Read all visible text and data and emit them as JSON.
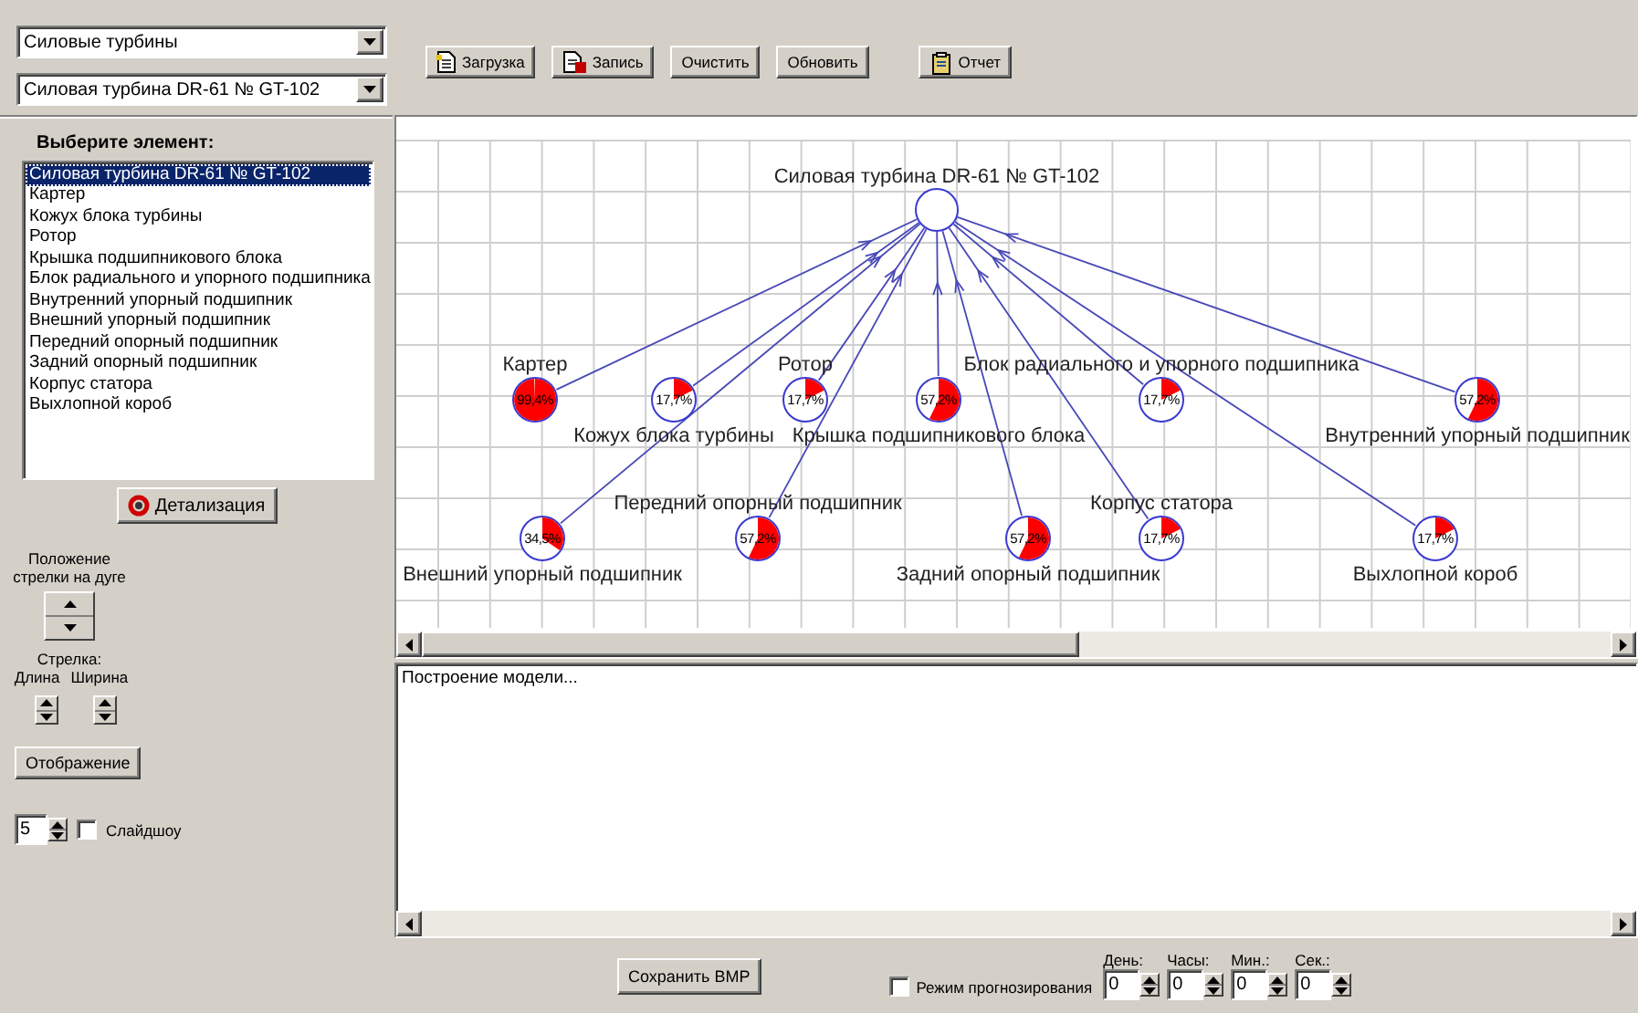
{
  "selectors": [
    {
      "value": "Силовые турбины"
    },
    {
      "value": "Силовая турбина DR-61 № GT-102"
    }
  ],
  "toolbar": [
    {
      "label": "Загрузка",
      "kind": "load"
    },
    {
      "label": "Запись",
      "kind": "save"
    },
    {
      "label": "Очистить",
      "kind": "plain"
    },
    {
      "label": "Обновить",
      "kind": "plain"
    },
    {
      "label": "Отчет",
      "kind": "report"
    }
  ],
  "element_list": {
    "title": "Выберите элемент:",
    "items": [
      {
        "label": "Силовая турбина DR-61 № GT-102",
        "selected": true
      },
      {
        "label": "Картер",
        "selected": false
      },
      {
        "label": "Кожух блока турбины",
        "selected": false
      },
      {
        "label": "Ротор",
        "selected": false
      },
      {
        "label": "Крышка подшипникового блока",
        "selected": false
      },
      {
        "label": "Блок радиального и упорного подшипника",
        "selected": false
      },
      {
        "label": "Внутренний упорный подшипник",
        "selected": false
      },
      {
        "label": "Внешний упорный подшипник",
        "selected": false
      },
      {
        "label": "Передний опорный подшипник",
        "selected": false
      },
      {
        "label": "Задний опорный подшипник",
        "selected": false
      },
      {
        "label": "Корпус статора",
        "selected": false
      },
      {
        "label": "Выхлопной короб",
        "selected": false
      }
    ]
  },
  "detail_button": "Детализация",
  "arrow_position_label": "Положение стрелки на дуге",
  "arrow_label": "Стрелка:",
  "length_label": "Длина",
  "width_label": "Ширина",
  "display_button": "Отображение",
  "slideshow": {
    "interval": "5",
    "label": "Слайдшоу",
    "checked": false
  },
  "diagram": {
    "root": "Силовая турбина DR-61 № GT-102",
    "nodes": [
      {
        "label": "Картер",
        "value": "99,4%"
      },
      {
        "label": "Кожух блока турбины",
        "value": "17,7%"
      },
      {
        "label": "Ротор",
        "value": "17,7%"
      },
      {
        "label": "Крышка подшипникового блока",
        "value": "57,2%"
      },
      {
        "label": "Блок радиального и упорного подшипника",
        "value": "17,7%"
      },
      {
        "label": "Внутренний упорный подшипник",
        "value": "57,2%"
      },
      {
        "label": "Внешний упорный подшипник",
        "value": "34,5%"
      },
      {
        "label": "Передний опорный подшипник",
        "value": "57,2%"
      },
      {
        "label": "Задний опорный подшипник",
        "value": "57,2%"
      },
      {
        "label": "Корпус статора",
        "value": "17,7%"
      },
      {
        "label": "Выхлопной короб",
        "value": "17,7%"
      }
    ]
  },
  "log": [
    "Построение модели..."
  ],
  "save_button": "Сохранить BMP",
  "forecast": {
    "label": "Режим прогнозирования",
    "checked": false,
    "fields": [
      {
        "label": "День:",
        "value": "0"
      },
      {
        "label": "Часы:",
        "value": "0"
      },
      {
        "label": "Мин.:",
        "value": "0"
      },
      {
        "label": "Сек.:",
        "value": "0"
      }
    ]
  }
}
